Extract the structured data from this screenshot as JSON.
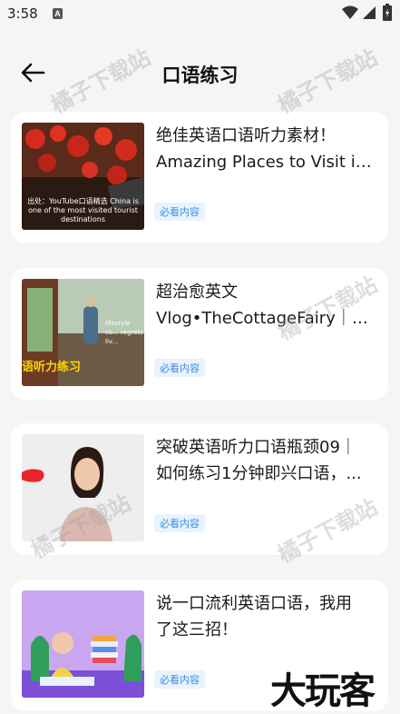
{
  "status": {
    "time": "3:58",
    "notif": "A"
  },
  "header": {
    "title": "口语练习"
  },
  "tag_label": "必看内容",
  "items": [
    {
      "title_line1": "绝佳英语口语听力素材！",
      "title_line2": "Amazing Places to Visit in...",
      "thumb_caption": "出处：YouTube口语精选 China is one of the most visited tourist destinations"
    },
    {
      "title_line1": "超治愈英文",
      "title_line2": "Vlog•TheCottageFairy｜英...",
      "thumb_caption": "语听力练习",
      "thumb_overlay": "lifestyle co... regrets liv..."
    },
    {
      "title_line1": "突破英语听力口语瓶颈09｜",
      "title_line2": "如何练习1分钟即兴口语，...",
      "thumb_caption": ""
    },
    {
      "title_line1": "说一口流利英语口语，我用",
      "title_line2": "了这三招！",
      "thumb_caption": ""
    }
  ],
  "watermarks": {
    "site": "橘子下载站",
    "brand": "大玩客"
  },
  "colors": {
    "tag_bg": "#eaf3fc",
    "tag_text": "#3a8ee6",
    "background": "#f5f5f5"
  }
}
